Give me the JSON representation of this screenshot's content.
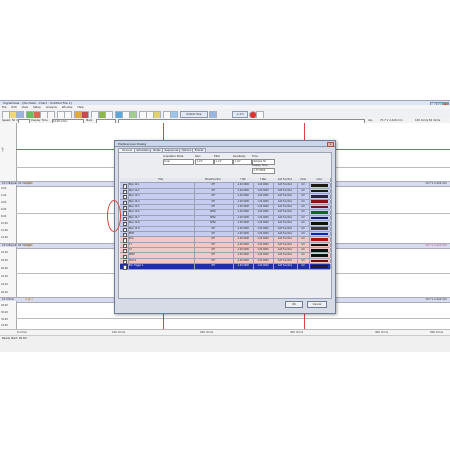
{
  "app": {
    "title": "SignalView - [No Data - Chart : Untitled File 1]",
    "window_buttons": [
      "_",
      "□",
      "x"
    ]
  },
  "menu": [
    "File",
    "Edit",
    "View",
    "Setup",
    "Analysis",
    "Window",
    "Help"
  ],
  "toolbar": {
    "default_view_label": "Default View",
    "scale_label": "+/-0.5"
  },
  "speedbar": {
    "speed_label": "Speed: 50 mm/s",
    "display_time_label": "Display Time",
    "display_time_value": "12.00 mm/s",
    "mark_label": "Mark",
    "all_label": "ALL",
    "right_info": "73.7 V 2.420 mm",
    "right_info_2": "100 mm/s 50 mm/s"
  },
  "plot": {
    "y_ticks": [
      "0.00",
      "2.00",
      "4.00",
      "6.00",
      "8.00",
      "10.00",
      "12.00",
      "14.00",
      "16.00",
      "18.00",
      "20.00",
      "22.00",
      "24.00",
      "26.00",
      "28.00",
      "30.00",
      "32.00",
      "34.00"
    ],
    "units": [
      "mV",
      "mV",
      "mV",
      "mV"
    ],
    "sections": [
      {
        "left": "Ch 1 Bipolar 10 mm/mV",
        "right": "10.7 V 2.420 mm"
      },
      {
        "left": "Ch 2 Bipolar 10 mm/mV",
        "right": "10.7 V 2.420 mm"
      },
      {
        "left": "Ch 3 ECG",
        "right": "10.7 V 2.420 mm"
      }
    ],
    "x_ticks": [
      "0 mm/s",
      "100 mm/s",
      "200 mm/s",
      "300 mm/s",
      "400 mm/s",
      "500 mm/s"
    ]
  },
  "statusbar": {
    "text": "Ready  Start: 00 Pm"
  },
  "dialog": {
    "title": "Preferences Dialog",
    "close": "x",
    "tabs": [
      "Channel",
      "Simulation",
      "Notes",
      "Sequences",
      "Options",
      "Events"
    ],
    "acquisition_mode_label": "Acquisition Mode",
    "acquisition_mode_value": "Dual",
    "gain_label": "Gain",
    "gain_value": "1 mV",
    "filter_label": "Filter",
    "filter_value": "1 mV",
    "sensitivity_label": "Sensitivity",
    "sensitivity_value": "1 mV",
    "time_label": "Time",
    "time_value": "Sample Hz",
    "display_time_label": "Display Time",
    "display_time_value": "1.75 0000",
    "columns": [
      "",
      "Title",
      "Mode/Function",
      "Y Min",
      "Y Max",
      "Add Function",
      "Units",
      "Color"
    ],
    "rows": [
      {
        "checked": true,
        "name": "Bipo 10-1",
        "mode": "Off",
        "ymin": "-1.00 0000",
        "ymax": "1.00 0000",
        "fn": "Add Function",
        "units": "mV",
        "color": "#1a1a1a",
        "bg": "#c6cdf0"
      },
      {
        "checked": true,
        "name": "Bipo 10-2",
        "mode": "Off",
        "ymin": "-1.00 0000",
        "ymax": "1.00 0000",
        "fn": "Add Function",
        "units": "mV",
        "color": "#1a1a1a",
        "bg": "#c6cdf0"
      },
      {
        "checked": true,
        "name": "Bipo 10-3",
        "mode": "Off",
        "ymin": "-1.00 0000",
        "ymax": "1.00 0000",
        "fn": "Add Function",
        "units": "mV",
        "color": "#2a2a2a",
        "bg": "#c6cdf0"
      },
      {
        "checked": true,
        "name": "Bipo 10-4",
        "mode": "Off",
        "ymin": "-1.00 0000",
        "ymax": "1.00 0000",
        "fn": "Add Function",
        "units": "mV",
        "color": "#8c1020",
        "bg": "#c6cdf0"
      },
      {
        "checked": true,
        "name": "Bipo 10-5",
        "mode": "Off",
        "ymin": "-1.00 0000",
        "ymax": "1.00 0000",
        "fn": "Add Function",
        "units": "mV",
        "color": "#7a0f30",
        "bg": "#c6cdf0"
      },
      {
        "checked": true,
        "name": "Bipo 10-6",
        "mode": "Differ",
        "ymin": "-1.00 0000",
        "ymax": "1.00 0000",
        "fn": "Add Function",
        "units": "mV",
        "color": "#0a6a20",
        "bg": "#c6cdf0"
      },
      {
        "checked": true,
        "name": "Bipo 10-7",
        "mode": "Differ",
        "ymin": "-1.00 0000",
        "ymax": "1.00 0000",
        "fn": "Add Function",
        "units": "mV",
        "color": "#12207a",
        "bg": "#c6cdf0"
      },
      {
        "checked": true,
        "name": "Bipo 10-8",
        "mode": "Differ",
        "ymin": "-1.00 0000",
        "ymax": "1.00 0000",
        "fn": "Add Function",
        "units": "mV",
        "color": "#101010",
        "bg": "#c6cdf0"
      },
      {
        "checked": true,
        "name": "Bipo 10-9",
        "mode": "Off",
        "ymin": "-1.00 0000",
        "ymax": "1.00 0000",
        "fn": "Add Function",
        "units": "mV",
        "color": "#3a3a3a",
        "bg": "#c6cdf0"
      },
      {
        "checked": true,
        "name": "BPM",
        "mode": "Off",
        "ymin": "-1.00 0000",
        "ymax": "1.00 0000",
        "fn": "Add Function",
        "units": "mV",
        "color": "#1020c0",
        "bg": "#c6cdf0"
      },
      {
        "checked": true,
        "name": "ECG",
        "mode": "Off",
        "ymin": "-1.00 0000",
        "ymax": "1.00 0000",
        "fn": "Add Function",
        "units": "mV",
        "color": "#b01010",
        "bg": "#f0c8c8"
      },
      {
        "checked": true,
        "name": "T1",
        "mode": "Off",
        "ymin": "-1.00 0000",
        "ymax": "1.00 0000",
        "fn": "Add Function",
        "units": "mV",
        "color": "#101010",
        "bg": "#f0c8c8"
      },
      {
        "checked": true,
        "name": "T2",
        "mode": "Off",
        "ymin": "-1.00 0000",
        "ymax": "1.00 0000",
        "fn": "Add Function",
        "units": "mV",
        "color": "#101010",
        "bg": "#f0c8c8"
      },
      {
        "checked": true,
        "name": "RESP",
        "mode": "Off",
        "ymin": "-1.00 0000",
        "ymax": "1.00 0000",
        "fn": "Add Function",
        "units": "mV",
        "color": "#101010",
        "bg": "#f0c8c8"
      },
      {
        "checked": true,
        "name": "Stimul",
        "mode": "Off",
        "ymin": "-1.00 0000",
        "ymax": "1.00 0000",
        "fn": "Add Function",
        "units": "mV",
        "color": "#6a1010",
        "bg": "#f0c8c8"
      },
      {
        "checked": true,
        "name": "Ext. Trigger 1",
        "mode": "Off",
        "ymin": "-1.00 0000",
        "ymax": "1.00 0000",
        "fn": "Add Function",
        "units": "mV",
        "color": "#202020",
        "bg": "#2030a0",
        "selected": true
      }
    ],
    "ok_label": "OK",
    "cancel_label": "Cancel"
  }
}
